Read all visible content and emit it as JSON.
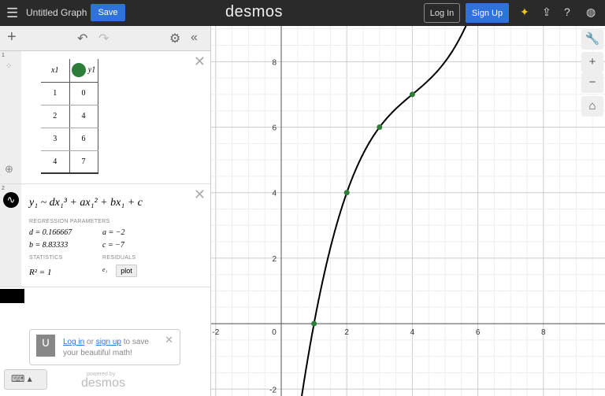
{
  "header": {
    "title": "Untitled Graph",
    "save": "Save",
    "logo": "desmos",
    "login": "Log In",
    "signup": "Sign Up"
  },
  "expressions": [
    {
      "index": "1",
      "table": {
        "headers": [
          "x1",
          "y1"
        ],
        "rows": [
          [
            "1",
            "0"
          ],
          [
            "2",
            "4"
          ],
          [
            "3",
            "6"
          ],
          [
            "4",
            "7"
          ]
        ]
      }
    },
    {
      "index": "2",
      "formula": "y₁ ~ dx₁³ + ax₁² + bx₁ + c",
      "params_label": "REGRESSION PARAMETERS",
      "params": {
        "d": "d = 0.166667",
        "a": "a = −2",
        "b": "b = 8.83333",
        "c": "c = −7"
      },
      "stats_label": "STATISTICS",
      "residuals_label": "RESIDUALS",
      "r2": "R² = 1",
      "residual_var": "e₁",
      "plot_button": "plot"
    }
  ],
  "banner": {
    "login": "Log in",
    "or": " or ",
    "signup": "sign up",
    "rest": " to save your beautiful math!"
  },
  "powered": {
    "by": "powered by",
    "name": "desmos"
  },
  "colors": {
    "accent": "#2f72dc",
    "points": "#2d7d3a"
  },
  "chart_data": {
    "type": "line",
    "xlim": [
      -2.14,
      9.88
    ],
    "ylim": [
      -2.21,
      9.09
    ],
    "x_ticks": [
      -2,
      0,
      2,
      4,
      6,
      8
    ],
    "y_ticks": [
      -2,
      2,
      4,
      6,
      8
    ],
    "points": [
      [
        1,
        0
      ],
      [
        2,
        4
      ],
      [
        3,
        6
      ],
      [
        4,
        7
      ]
    ],
    "curve": {
      "d": 0.166667,
      "a": -2,
      "b": 8.83333,
      "c": -7
    }
  }
}
